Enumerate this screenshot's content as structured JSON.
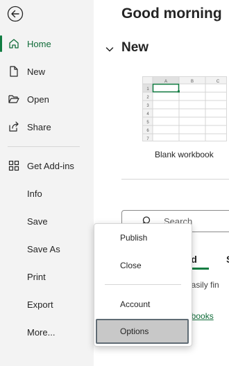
{
  "sidebar": {
    "back_icon": "back-arrow-circle-icon",
    "items": [
      {
        "label": "Home",
        "icon": "home-icon",
        "active": true
      },
      {
        "label": "New",
        "icon": "new-document-icon"
      },
      {
        "label": "Open",
        "icon": "open-folder-icon"
      },
      {
        "label": "Share",
        "icon": "share-icon"
      },
      {
        "label": "Get Add-ins",
        "icon": "add-ins-grid-icon"
      },
      {
        "label": "Info"
      },
      {
        "label": "Save"
      },
      {
        "label": "Save As"
      },
      {
        "label": "Print"
      },
      {
        "label": "Export"
      },
      {
        "label": "More..."
      }
    ]
  },
  "main": {
    "greeting": "Good morning",
    "new_section": {
      "title": "New",
      "chevron_icon": "chevron-down-icon"
    },
    "blank_workbook": {
      "label": "Blank workbook",
      "columns": [
        "A",
        "B",
        "C"
      ],
      "rows": [
        "1",
        "2",
        "3",
        "4",
        "5",
        "6",
        "7"
      ]
    },
    "search": {
      "placeholder": "Search",
      "icon": "search-icon"
    },
    "tab": {
      "label": "ned",
      "next_label": "S"
    },
    "info_text": "o easily fin",
    "link_text": "orkbooks"
  },
  "popup_menu": {
    "items": [
      "Publish",
      "Close",
      "Account",
      "Options"
    ],
    "selected": "Options"
  },
  "colors": {
    "accent": "#107c41",
    "sidebar_bg": "#f3f3f3",
    "selected_bg": "#c8c8c8",
    "selected_border": "#5f6b74"
  }
}
